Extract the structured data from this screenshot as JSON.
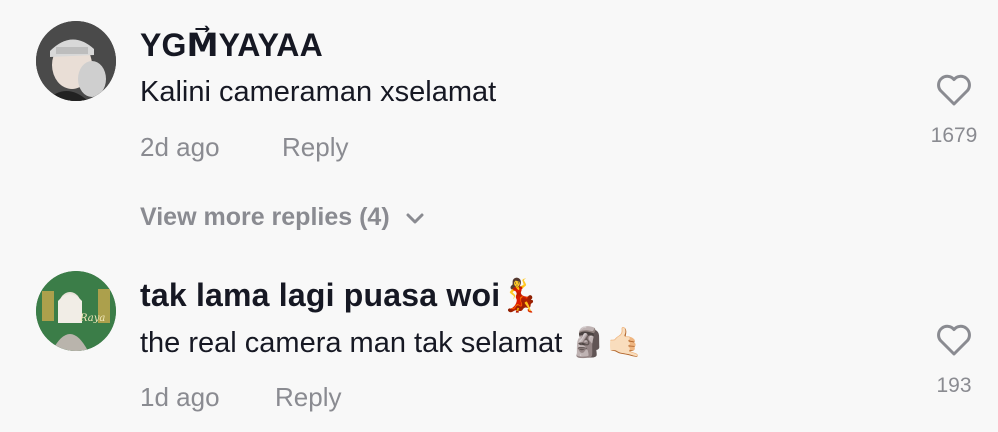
{
  "comments": [
    {
      "username": "YGM⃗YAYAA",
      "text": "Kalini cameraman xselamat",
      "time": "2d ago",
      "reply_label": "Reply",
      "like_count": "1679",
      "like_icon": "heart-outline-icon"
    },
    {
      "username": "tak lama lagi puasa woi💃",
      "text": "the real camera man tak selamat 🗿🤙🏻",
      "time": "1d ago",
      "reply_label": "Reply",
      "like_count": "193",
      "like_icon": "heart-outline-icon"
    }
  ],
  "view_more": {
    "label": "View more replies (4)",
    "icon": "chevron-down-icon"
  },
  "colors": {
    "background": "#f8f8f8",
    "primary_text": "#161823",
    "secondary_text": "#8a8b91",
    "icon": "#8a8b91"
  }
}
